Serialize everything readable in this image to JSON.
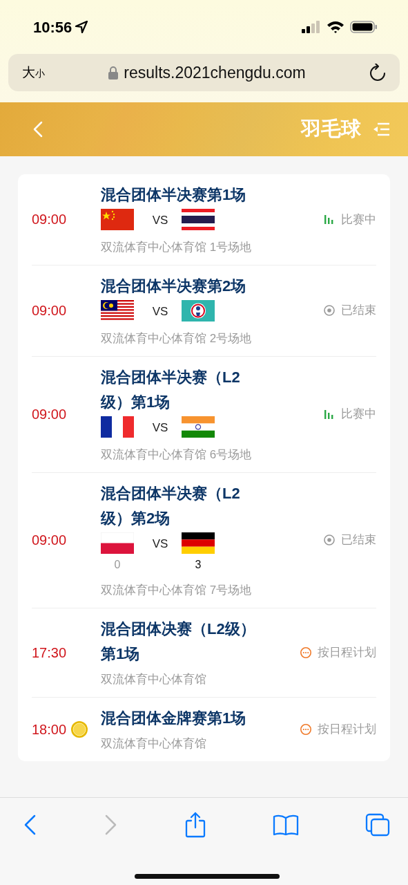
{
  "status_bar": {
    "time": "10:56"
  },
  "browser": {
    "format_button": "大小",
    "url": "results.2021chengdu.com"
  },
  "header": {
    "title": "羽毛球"
  },
  "matches": [
    {
      "time": "09:00",
      "medal": false,
      "title": "混合团体半决赛第1场",
      "teams": [
        {
          "kind": "china"
        },
        {
          "kind": "thailand"
        }
      ],
      "vs": "VS",
      "venue": "双流体育中心体育馆 1号场地",
      "status": {
        "kind": "live",
        "label": "比赛中"
      }
    },
    {
      "time": "09:00",
      "medal": false,
      "title": "混合团体半决赛第2场",
      "teams": [
        {
          "kind": "malaysia"
        },
        {
          "kind": "chinese_taipei"
        }
      ],
      "vs": "VS",
      "venue": "双流体育中心体育馆 2号场地",
      "status": {
        "kind": "ended",
        "label": "已结束"
      }
    },
    {
      "time": "09:00",
      "medal": false,
      "title": "混合团体半决赛（L2级）第1场",
      "teams": [
        {
          "kind": "france"
        },
        {
          "kind": "india"
        }
      ],
      "vs": "VS",
      "venue": "双流体育中心体育馆 6号场地",
      "status": {
        "kind": "live",
        "label": "比赛中"
      }
    },
    {
      "time": "09:00",
      "medal": false,
      "title": "混合团体半决赛（L2级）第2场",
      "teams": [
        {
          "kind": "poland",
          "score": "0",
          "winner": false
        },
        {
          "kind": "germany",
          "score": "3",
          "winner": true
        }
      ],
      "vs": "VS",
      "venue": "双流体育中心体育馆 7号场地",
      "status": {
        "kind": "ended",
        "label": "已结束"
      }
    },
    {
      "time": "17:30",
      "medal": false,
      "title": "混合团体决赛（L2级）第1场",
      "venue": "双流体育中心体育馆",
      "status": {
        "kind": "scheduled",
        "label": "按日程计划"
      }
    },
    {
      "time": "18:00",
      "medal": true,
      "title": "混合团体金牌赛第1场",
      "venue": "双流体育中心体育馆",
      "status": {
        "kind": "scheduled",
        "label": "按日程计划"
      }
    }
  ]
}
